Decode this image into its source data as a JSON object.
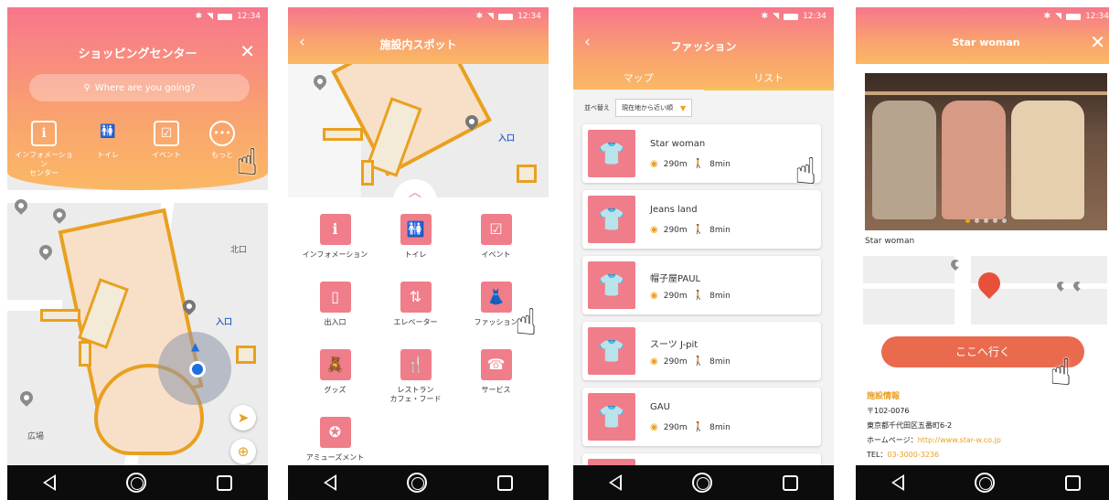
{
  "status_bar": {
    "time": "12:34"
  },
  "screen1": {
    "title": "ショッピングセンター",
    "search_placeholder": "Where are you going?",
    "categories": [
      {
        "label": "インフォメーション\nセンター",
        "icon": "info-icon"
      },
      {
        "label": "トイレ",
        "icon": "restroom-icon"
      },
      {
        "label": "イベント",
        "icon": "calendar-icon"
      },
      {
        "label": "もっと",
        "icon": "more-icon"
      }
    ],
    "map_labels": {
      "north_exit": "北口",
      "entrance": "入口",
      "plaza": "広場"
    }
  },
  "screen2": {
    "title": "施設内スポット",
    "map_labels": {
      "entrance": "入口"
    },
    "categories": [
      {
        "label": "インフォメーション",
        "icon": "info-icon"
      },
      {
        "label": "トイレ",
        "icon": "restroom-icon"
      },
      {
        "label": "イベント",
        "icon": "calendar-icon"
      },
      {
        "label": "出入口",
        "icon": "door-icon"
      },
      {
        "label": "エレベーター",
        "icon": "elevator-icon"
      },
      {
        "label": "ファッション",
        "icon": "clothes-icon"
      },
      {
        "label": "グッズ",
        "icon": "goods-icon"
      },
      {
        "label": "レストラン\nカフェ・フード",
        "icon": "restaurant-icon"
      },
      {
        "label": "サービス",
        "icon": "service-icon"
      },
      {
        "label": "アミューズメント",
        "icon": "amusement-icon"
      }
    ]
  },
  "screen3": {
    "title": "ファッション",
    "tabs": [
      "マップ",
      "リスト"
    ],
    "sort_label": "並べ替え",
    "sort_value": "現在地から近い順",
    "shops": [
      {
        "name": "Star woman",
        "distance": "290m",
        "time": "8min"
      },
      {
        "name": "Jeans land",
        "distance": "290m",
        "time": "8min"
      },
      {
        "name": "帽子屋PAUL",
        "distance": "290m",
        "time": "8min"
      },
      {
        "name": "スーツ J-pit",
        "distance": "290m",
        "time": "8min"
      },
      {
        "name": "GAU",
        "distance": "290m",
        "time": "8min"
      }
    ]
  },
  "screen4": {
    "title": "Star woman",
    "shop_name": "Star woman",
    "go_button": "ここへ行く",
    "info_heading": "施設情報",
    "postal": "〒102-0076",
    "address": "東京都千代田区五番町6-2",
    "homepage_label": "ホームページ：",
    "homepage_url": "http://www.star-w.co.jp",
    "tel_label": "TEL：",
    "tel": "03-3000-3236"
  },
  "colors": {
    "header_start": "#f7768c",
    "header_end": "#fbb864",
    "accent": "#e9a020",
    "category": "#f07d8a",
    "go_button": "#ea6a4e"
  }
}
